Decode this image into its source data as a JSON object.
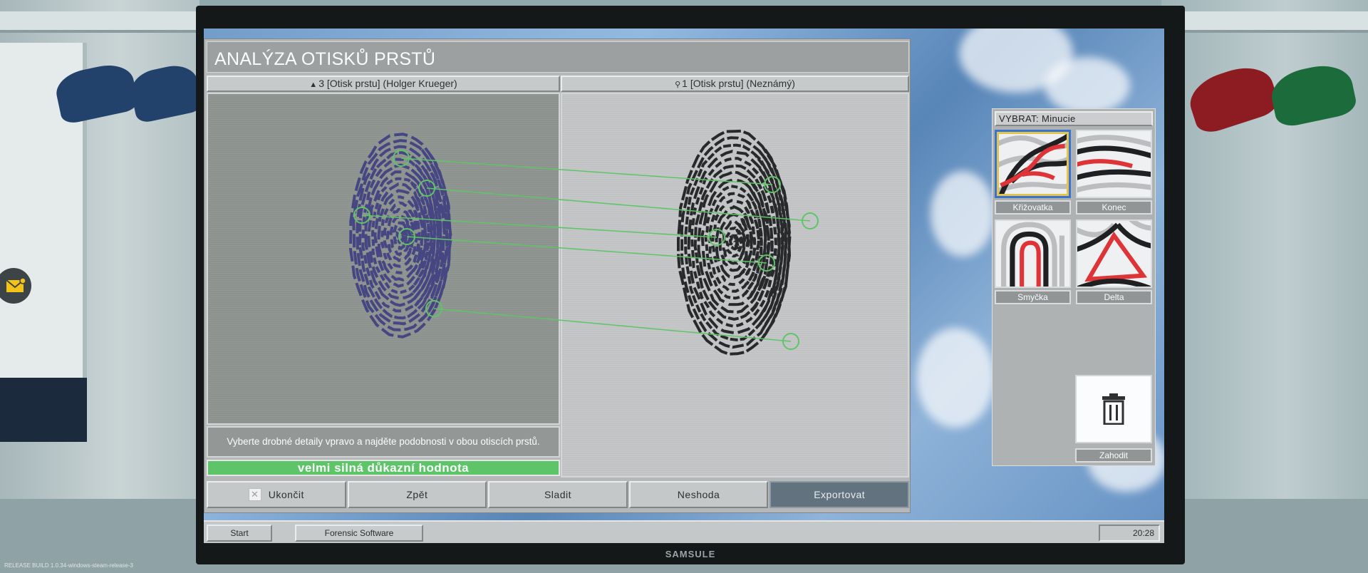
{
  "app": {
    "title": "ANALÝZA OTISKŮ PRSTŮ",
    "left_header": {
      "icon": "person-icon",
      "text": "3 [Otisk prstu] (Holger Krueger)"
    },
    "right_header": {
      "icon": "location-pin-icon",
      "text": "1 [Otisk prstu] (Neznámý)"
    },
    "hint": "Vyberte drobné detaily vpravo a najděte podobnosti v obou otiscích prstů.",
    "verdict": "velmi silná důkazní hodnota",
    "verdict_color": "#54c35d",
    "buttons": {
      "quit": "Ukončit",
      "back": "Zpět",
      "match": "Sladit",
      "mismatch": "Neshoda",
      "export": "Exportovat"
    },
    "matched_minutiae_count": 5
  },
  "minutiae_panel": {
    "title": "VYBRAT: Minucie",
    "types": [
      {
        "label": "Křižovatka",
        "selected": true
      },
      {
        "label": "Konec",
        "selected": false
      },
      {
        "label": "Smyčka",
        "selected": false
      },
      {
        "label": "Delta",
        "selected": false
      }
    ],
    "discard_label": "Zahodit"
  },
  "taskbar": {
    "start": "Start",
    "window": "Forensic Software",
    "clock": "20:28"
  },
  "monitor_brand": "SAMSULE",
  "build_info": "RELEASE   BUILD 1.0.34-windows-steam-release-3"
}
